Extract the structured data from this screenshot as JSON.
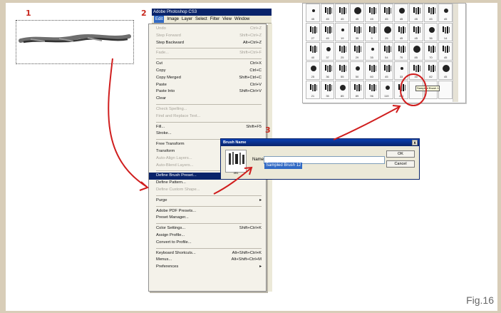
{
  "steps": [
    "1",
    "2",
    "3"
  ],
  "photoshop": {
    "title": "Adobe Photoshop CS3",
    "menubar": [
      "Edit",
      "Image",
      "Layer",
      "Select",
      "Filter",
      "View",
      "Window"
    ],
    "menu_items": [
      {
        "label": "Undo",
        "shortcut": "Ctrl+Z",
        "state": "disabled"
      },
      {
        "label": "Step Forward",
        "shortcut": "Shift+Ctrl+Z",
        "state": "disabled"
      },
      {
        "label": "Step Backward",
        "shortcut": "Alt+Ctrl+Z",
        "state": "normal"
      },
      {
        "sep": true
      },
      {
        "label": "Fade...",
        "shortcut": "Shift+Ctrl+F",
        "state": "disabled"
      },
      {
        "sep": true
      },
      {
        "label": "Cut",
        "shortcut": "Ctrl+X",
        "state": "normal"
      },
      {
        "label": "Copy",
        "shortcut": "Ctrl+C",
        "state": "normal"
      },
      {
        "label": "Copy Merged",
        "shortcut": "Shift+Ctrl+C",
        "state": "normal"
      },
      {
        "label": "Paste",
        "shortcut": "Ctrl+V",
        "state": "normal"
      },
      {
        "label": "Paste Into",
        "shortcut": "Shift+Ctrl+V",
        "state": "normal"
      },
      {
        "label": "Clear",
        "shortcut": "",
        "state": "normal"
      },
      {
        "sep": true
      },
      {
        "label": "Check Spelling...",
        "shortcut": "",
        "state": "disabled"
      },
      {
        "label": "Find and Replace Text...",
        "shortcut": "",
        "state": "disabled"
      },
      {
        "sep": true
      },
      {
        "label": "Fill...",
        "shortcut": "Shift+F5",
        "state": "normal"
      },
      {
        "label": "Stroke...",
        "shortcut": "",
        "state": "normal"
      },
      {
        "sep": true
      },
      {
        "label": "Free Transform",
        "shortcut": "Ctrl+T",
        "state": "normal"
      },
      {
        "label": "Transform",
        "shortcut": "",
        "state": "normal"
      },
      {
        "label": "Auto-Align Layers...",
        "shortcut": "",
        "state": "disabled"
      },
      {
        "label": "Auto-Blend Layers...",
        "shortcut": "",
        "state": "disabled"
      },
      {
        "sep": true
      },
      {
        "label": "Define Brush Preset...",
        "shortcut": "",
        "state": "highlight"
      },
      {
        "label": "Define Pattern...",
        "shortcut": "",
        "state": "normal"
      },
      {
        "label": "Define Custom Shape...",
        "shortcut": "",
        "state": "disabled"
      },
      {
        "sep": true
      },
      {
        "label": "Purge",
        "shortcut": "▸",
        "state": "normal"
      },
      {
        "sep": true
      },
      {
        "label": "Adobe PDF Presets...",
        "shortcut": "",
        "state": "normal"
      },
      {
        "label": "Preset Manager...",
        "shortcut": "",
        "state": "normal"
      },
      {
        "sep": true
      },
      {
        "label": "Color Settings...",
        "shortcut": "Shift+Ctrl+K",
        "state": "normal"
      },
      {
        "label": "Assign Profile...",
        "shortcut": "",
        "state": "normal"
      },
      {
        "label": "Convert to Profile...",
        "shortcut": "",
        "state": "normal"
      },
      {
        "sep": true
      },
      {
        "label": "Keyboard Shortcuts...",
        "shortcut": "Alt+Shift+Ctrl+K",
        "state": "normal"
      },
      {
        "label": "Menus...",
        "shortcut": "Alt+Shift+Ctrl+M",
        "state": "normal"
      },
      {
        "label": "Preferences",
        "shortcut": "▸",
        "state": "normal"
      }
    ]
  },
  "dialog": {
    "title": "Brush Name",
    "close": "x",
    "name_label": "Name:",
    "name_value": "Sampled Brush 12",
    "ok": "OK",
    "cancel": "Cancel",
    "thumb_size": "491"
  },
  "palette": {
    "tooltip": "Sampled Brush 12",
    "cells": [
      "45",
      "45",
      "45",
      "45",
      "45",
      "45",
      "45",
      "45",
      "45",
      "45",
      "27",
      "45",
      "19",
      "35",
      "9",
      "25",
      "45",
      "45",
      "36",
      "14",
      "40",
      "37",
      "25",
      "29",
      "35",
      "54",
      "70",
      "85",
      "70",
      "45",
      "25",
      "36",
      "55",
      "50",
      "60",
      "45",
      "33",
      "40",
      "82",
      "45",
      "21",
      "35",
      "85",
      "89",
      "96",
      "119",
      "491",
      "",
      "",
      ""
    ]
  },
  "caption": "Fig.16",
  "colors": {
    "annotation": "#d01e1e",
    "menu_highlight": "#0a246a",
    "selection": "#316ac5"
  }
}
